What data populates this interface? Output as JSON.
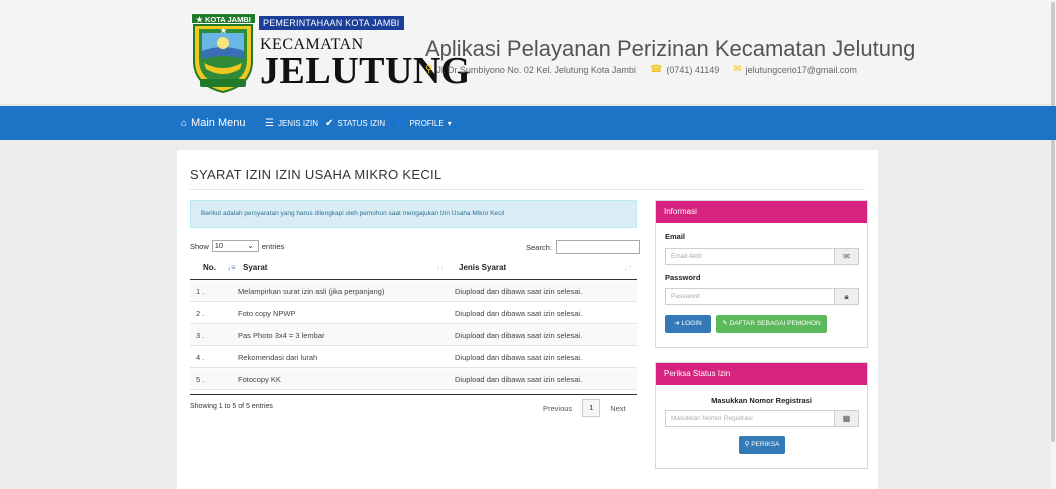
{
  "header": {
    "emblem_tag": "★ KOTA JAMBI ★",
    "logo_line1": "PEMERINTAHAAN KOTA JAMBI",
    "logo_line2": "KECAMATAN",
    "logo_line3": "JELUTUNG",
    "app_title": "Aplikasi Pelayanan Perizinan Kecamatan Jelutung",
    "address": "Jl. Dr Sumbiyono No. 02 Kel. Jelutung Kota Jambi",
    "phone": "(0741) 41149",
    "email": "jelutungcerio17@gmail.com"
  },
  "nav": {
    "main": "Main Menu",
    "jenis": "JENIS IZIN",
    "status": "STATUS IZIN",
    "profile": "PROFILE",
    "caret": "▾"
  },
  "page": {
    "title": "SYARAT IZIN IZIN USAHA MIKRO KECIL",
    "alert": "Berikut adalah persyaratan yang harus dilengkapi oleh pemohon saat mengajukan Izin Usaha Mikro Kecil"
  },
  "table": {
    "show_label": "Show",
    "show_value": "10",
    "entries_label": "entries",
    "search_label": "Search:",
    "columns": [
      "No.",
      "Syarat",
      "Jenis Syarat"
    ],
    "rows": [
      {
        "no": "1 .",
        "syarat": "Melampirkan surat izin asli (jika perpanjang)",
        "jenis": "Diupload dan dibawa saat izin selesai."
      },
      {
        "no": "2 .",
        "syarat": "Foto copy NPWP",
        "jenis": "Diupload dan dibawa saat izin selesai."
      },
      {
        "no": "3 .",
        "syarat": "Pas Photo 3x4 = 3 lembar",
        "jenis": "Diupload dan dibawa saat izin selesai."
      },
      {
        "no": "4 .",
        "syarat": "Rekomendasi dari lurah",
        "jenis": "Diupload dan dibawa saat izin selesai."
      },
      {
        "no": "5 .",
        "syarat": "Fotocopy KK",
        "jenis": "Diupload dan dibawa saat izin selesai."
      }
    ],
    "info": "Showing 1 to 5 of 5 entries",
    "prev": "Previous",
    "page": "1",
    "next": "Next"
  },
  "login": {
    "heading": "Informasi",
    "email_label": "Email",
    "email_placeholder": "Email Aktif",
    "password_label": "Password",
    "password_placeholder": "Password",
    "login_button": "LOGIN",
    "register_button": "DAFTAR SEBAGAI PEMOHON"
  },
  "status_box": {
    "heading": "Periksa Status Izin",
    "label": "Masukkan Nomor Registrasi",
    "placeholder": "Masukkan Nomor Registrasi",
    "button": "PERIKSA"
  },
  "icons": {
    "home": "home-icon",
    "list": "list-icon",
    "check": "check-circle-icon",
    "user": "user-icon",
    "pin": "map-pin-icon",
    "phone": "phone-icon",
    "mail": "envelope-icon",
    "lock": "lock-icon",
    "qr": "qrcode-icon",
    "search": "search-icon",
    "signin": "sign-in-icon",
    "edit": "edit-icon"
  },
  "colors": {
    "navbar": "#1d74c7",
    "box_header": "#d6237f",
    "btn_primary": "#337ab7",
    "btn_success": "#5cb85c",
    "alert_bg": "#d9edf7"
  }
}
